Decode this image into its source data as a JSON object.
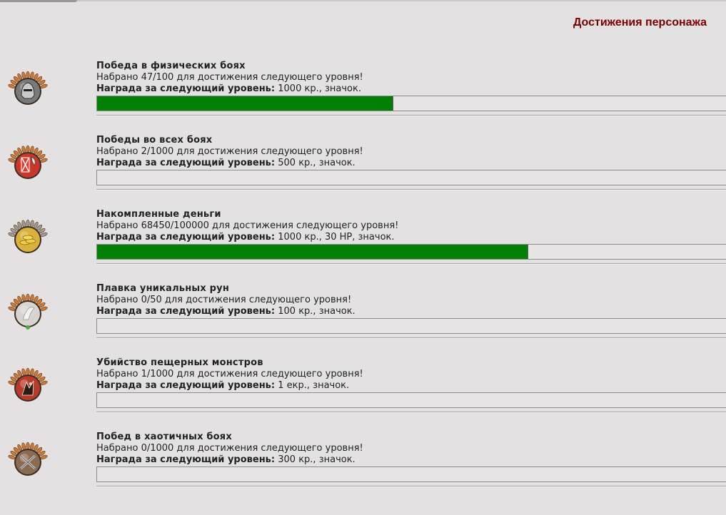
{
  "page_title": "Достижения персонажа",
  "reward_label": "Награда за следующий уровень:",
  "achievements": [
    {
      "name": "Победа в физических боях",
      "icon": "knight-helmet-laurel-icon",
      "progress_text": "Набрано 47/100 для достижения следующего уровня!",
      "reward": "1000 кр., значок.",
      "progress": 0.47,
      "colors": {
        "ring": "#c9793a",
        "center": "#7a7a7a"
      }
    },
    {
      "name": "Победы во всех боях",
      "icon": "red-banner-axe-laurel-icon",
      "progress_text": "Набрано 2/1000 для достижения следующего уровня!",
      "reward": "500 кр., значок.",
      "progress": 0.002,
      "colors": {
        "ring": "#c9793a",
        "center": "#c8382a"
      }
    },
    {
      "name": "Накомпленные деньги",
      "icon": "gold-coins-silver-laurel-icon",
      "progress_text": "Набрано 68450/100000 для достижения следующего уровня!",
      "reward": "1000 кр., 30 HP, значок.",
      "progress": 0.6845,
      "colors": {
        "ring": "#9a9a9a",
        "center": "#d8b23a"
      }
    },
    {
      "name": "Плавка уникальных рун",
      "icon": "rune-laurel-icon",
      "progress_text": "Набрано 0/50 для достижения следующего уровня!",
      "reward": "100 кр., значок.",
      "progress": 0,
      "colors": {
        "ring": "#c9793a",
        "center": "#d9d4cf"
      }
    },
    {
      "name": "Убийство пещерных монстров",
      "icon": "cave-monster-laurel-icon",
      "progress_text": "Набрано 1/1000 для достижения следующего уровня!",
      "reward": "1 екр., значок.",
      "progress": 0.001,
      "colors": {
        "ring": "#c9793a",
        "center": "#b83a2a"
      }
    },
    {
      "name": "Побед в хаотичных боях",
      "icon": "crossed-swords-laurel-icon",
      "progress_text": "Набрано 0/1000 для достижения следующего уровня!",
      "reward": "300 кр., значок.",
      "progress": 0,
      "colors": {
        "ring": "#c9793a",
        "center": "#8a6a50"
      }
    }
  ]
}
